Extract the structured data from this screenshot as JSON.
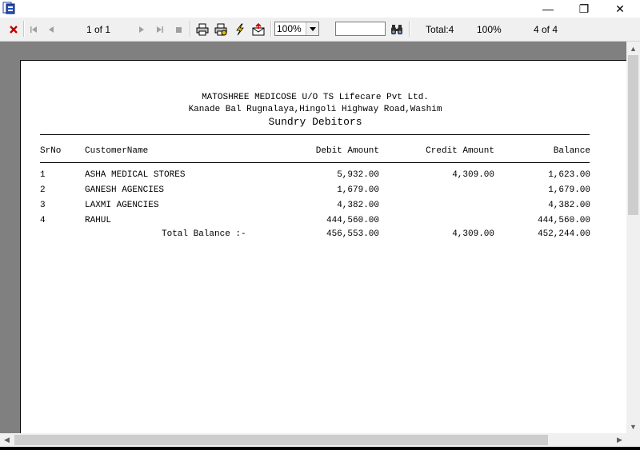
{
  "window": {
    "minimize_glyph": "—",
    "maximize_glyph": "❐",
    "close_glyph": "✕"
  },
  "toolbar": {
    "page_indicator": "1 of 1",
    "zoom_value": "100%",
    "search_value": "",
    "total_label": "Total:4",
    "percent_label": "100%",
    "count_label": "4 of 4"
  },
  "report": {
    "company": "MATOSHREE MEDICOSE U/O TS Lifecare Pvt Ltd.",
    "address": "Kanade Bal Rugnalaya,Hingoli Highway Road,Washim",
    "title": "Sundry Debitors",
    "headers": {
      "srno": "SrNo",
      "customer": "CustomerName",
      "debit": "Debit Amount",
      "credit": "Credit Amount",
      "balance": "Balance"
    },
    "rows": [
      {
        "srno": "1",
        "customer": "ASHA MEDICAL STORES",
        "debit": "5,932.00",
        "credit": "4,309.00",
        "balance": "1,623.00"
      },
      {
        "srno": "2",
        "customer": "GANESH AGENCIES",
        "debit": "1,679.00",
        "credit": "",
        "balance": "1,679.00"
      },
      {
        "srno": "3",
        "customer": "LAXMI AGENCIES",
        "debit": "4,382.00",
        "credit": "",
        "balance": "4,382.00"
      },
      {
        "srno": "4",
        "customer": "RAHUL",
        "debit": "444,560.00",
        "credit": "",
        "balance": "444,560.00"
      }
    ],
    "total": {
      "label": "Total Balance :-",
      "debit": "456,553.00",
      "credit": "4,309.00",
      "balance": "452,244.00"
    }
  }
}
